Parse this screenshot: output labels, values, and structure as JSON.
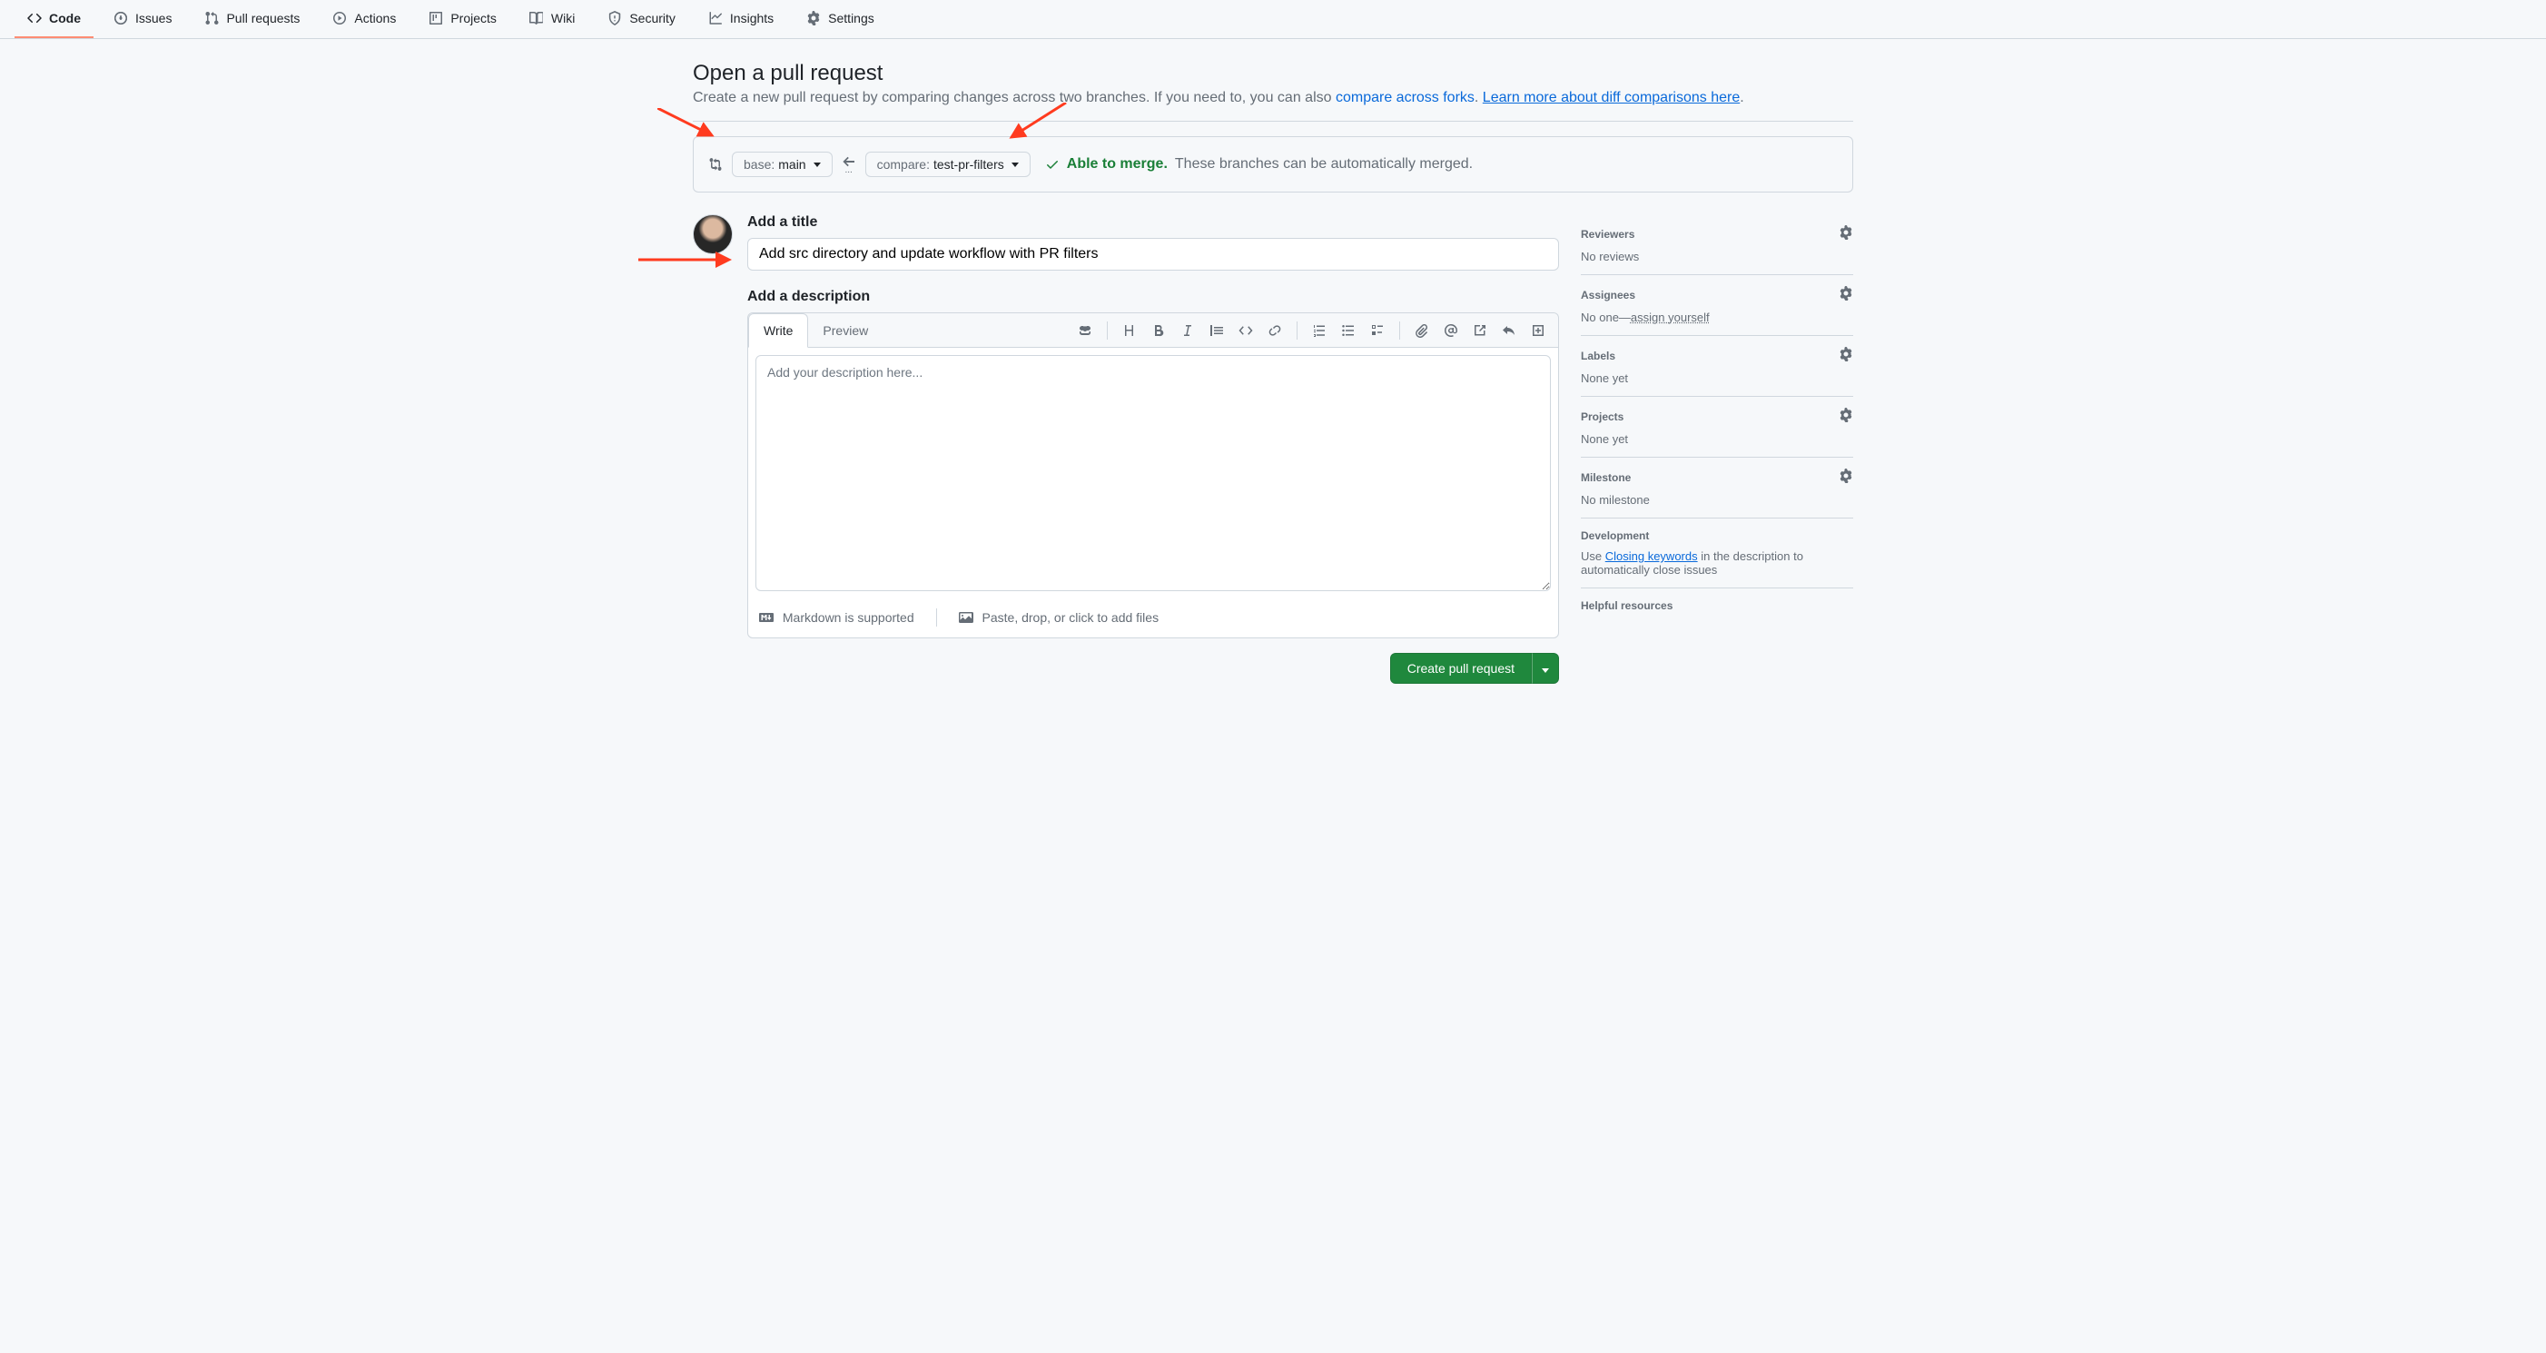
{
  "nav": {
    "code": "Code",
    "issues": "Issues",
    "pulls": "Pull requests",
    "actions": "Actions",
    "projects": "Projects",
    "wiki": "Wiki",
    "security": "Security",
    "insights": "Insights",
    "settings": "Settings"
  },
  "header": {
    "title": "Open a pull request",
    "subtitle_prefix": "Create a new pull request by comparing changes across two branches. If you need to, you can also ",
    "compare_forks_link": "compare across forks",
    "subtitle_period": ". ",
    "learn_link": "Learn more about diff comparisons here",
    "subtitle_end": "."
  },
  "compare": {
    "base_prefix": "base: ",
    "base_branch": "main",
    "compare_prefix": "compare: ",
    "compare_branch": "test-pr-filters",
    "able": "Able to merge.",
    "auto": "These branches can be automatically merged."
  },
  "form": {
    "title_label": "Add a title",
    "title_value": "Add src directory and update workflow with PR filters",
    "desc_label": "Add a description",
    "write_tab": "Write",
    "preview_tab": "Preview",
    "desc_placeholder": "Add your description here...",
    "markdown_note": "Markdown is supported",
    "paste_note": "Paste, drop, or click to add files",
    "create_btn": "Create pull request"
  },
  "sidebar": {
    "reviewers": {
      "title": "Reviewers",
      "body": "No reviews"
    },
    "assignees": {
      "title": "Assignees",
      "body_prefix": "No one—",
      "assign_self": "assign yourself"
    },
    "labels": {
      "title": "Labels",
      "body": "None yet"
    },
    "projects": {
      "title": "Projects",
      "body": "None yet"
    },
    "milestone": {
      "title": "Milestone",
      "body": "No milestone"
    },
    "development": {
      "title": "Development",
      "body_prefix": "Use ",
      "closing_link": "Closing keywords",
      "body_suffix": " in the description to automatically close issues"
    },
    "resources": {
      "title": "Helpful resources"
    }
  }
}
